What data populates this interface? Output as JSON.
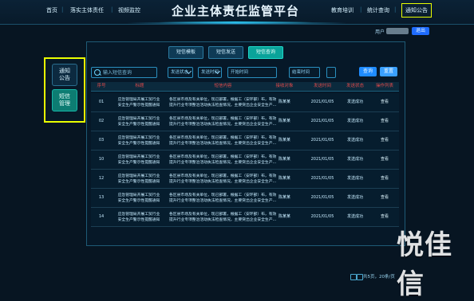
{
  "header": {
    "nav_left": [
      "首页",
      "落实主体责任",
      "视频监控"
    ],
    "title": "企业主体责任监管平台",
    "nav_right": [
      "教育培训",
      "统计查询",
      "通知公告"
    ]
  },
  "user": {
    "label": "用户",
    "logout": "退出"
  },
  "sidebar": {
    "items": [
      "通知\n公告",
      "短信\n管理"
    ]
  },
  "tabs": [
    "短信模板",
    "短信发送",
    "短信查询"
  ],
  "filters": {
    "search_placeholder": "输入短信查询",
    "select1": "发送状态",
    "select2": "发送时间",
    "date_placeholder": "开始时间",
    "date2_placeholder": "结束时间",
    "btn_query": "查询",
    "btn_reset": "重置"
  },
  "table": {
    "headers": [
      "序号",
      "标题",
      "短信内容",
      "接收对象",
      "发送时间",
      "发送状态",
      "操作列表"
    ],
    "rows": [
      {
        "no": "01",
        "title": "应急管理局开展工贸行业\n安全生产警示性提醒通知",
        "content": "各区县市场及有关单位，现已部署，根据工（安环部）布，有效\n提升行业专项整治活动执法检查情况，主要突出企业安全生产…",
        "to": "陈某某",
        "time": "2021/01/05",
        "status": "发送成功",
        "op": "查看"
      },
      {
        "no": "02",
        "title": "应急管理局开展工贸行业\n安全生产警示性提醒通知",
        "content": "各区县市场及有关单位，现已部署，根据工（安环部）布，有效\n提升行业专项整治活动执法检查情况，主要突出企业安全生产…",
        "to": "陈某某",
        "time": "2021/01/05",
        "status": "发送成功",
        "op": "查看"
      },
      {
        "no": "03",
        "title": "应急管理局开展工贸行业\n安全生产警示性提醒通知",
        "content": "各区县市场及有关单位，现已部署，根据工（安环部）布，有效\n提升行业专项整治活动执法检查情况，主要突出企业安全生产…",
        "to": "陈某某",
        "time": "2021/01/05",
        "status": "发送成功",
        "op": "查看"
      },
      {
        "no": "10",
        "title": "应急管理局开展工贸行业\n安全生产警示性提醒通知",
        "content": "各区县市场及有关单位，现已部署，根据工（安环部）布，有效\n提升行业专项整治活动执法检查情况，主要突出企业安全生产…",
        "to": "陈某某",
        "time": "2021/01/05",
        "status": "发送成功",
        "op": "查看"
      },
      {
        "no": "12",
        "title": "应急管理局开展工贸行业\n安全生产警示性提醒通知",
        "content": "各区县市场及有关单位，现已部署，根据工（安环部）布，有效\n提升行业专项整治活动执法检查情况，主要突出企业安全生产…",
        "to": "陈某某",
        "time": "2021/01/05",
        "status": "发送成功",
        "op": "查看"
      },
      {
        "no": "13",
        "title": "应急管理局开展工贸行业\n安全生产警示性提醒通知",
        "content": "各区县市场及有关单位，现已部署，根据工（安环部）布，有效\n提升行业专项整治活动执法检查情况，主要突出企业安全生产…",
        "to": "陈某某",
        "time": "2021/01/05",
        "status": "发送成功",
        "op": "查看"
      },
      {
        "no": "14",
        "title": "应急管理局开展工贸行业\n安全生产警示性提醒通知",
        "content": "各区县市场及有关单位，现已部署，根据工（安环部）布，有效\n提升行业专项整治活动执法检查情况，主要突出企业安全生产…",
        "to": "陈某某",
        "time": "2021/01/05",
        "status": "发送成功",
        "op": "查看"
      }
    ]
  },
  "pager": {
    "text": "共5页，20条/页"
  },
  "watermark": "悦佳信"
}
